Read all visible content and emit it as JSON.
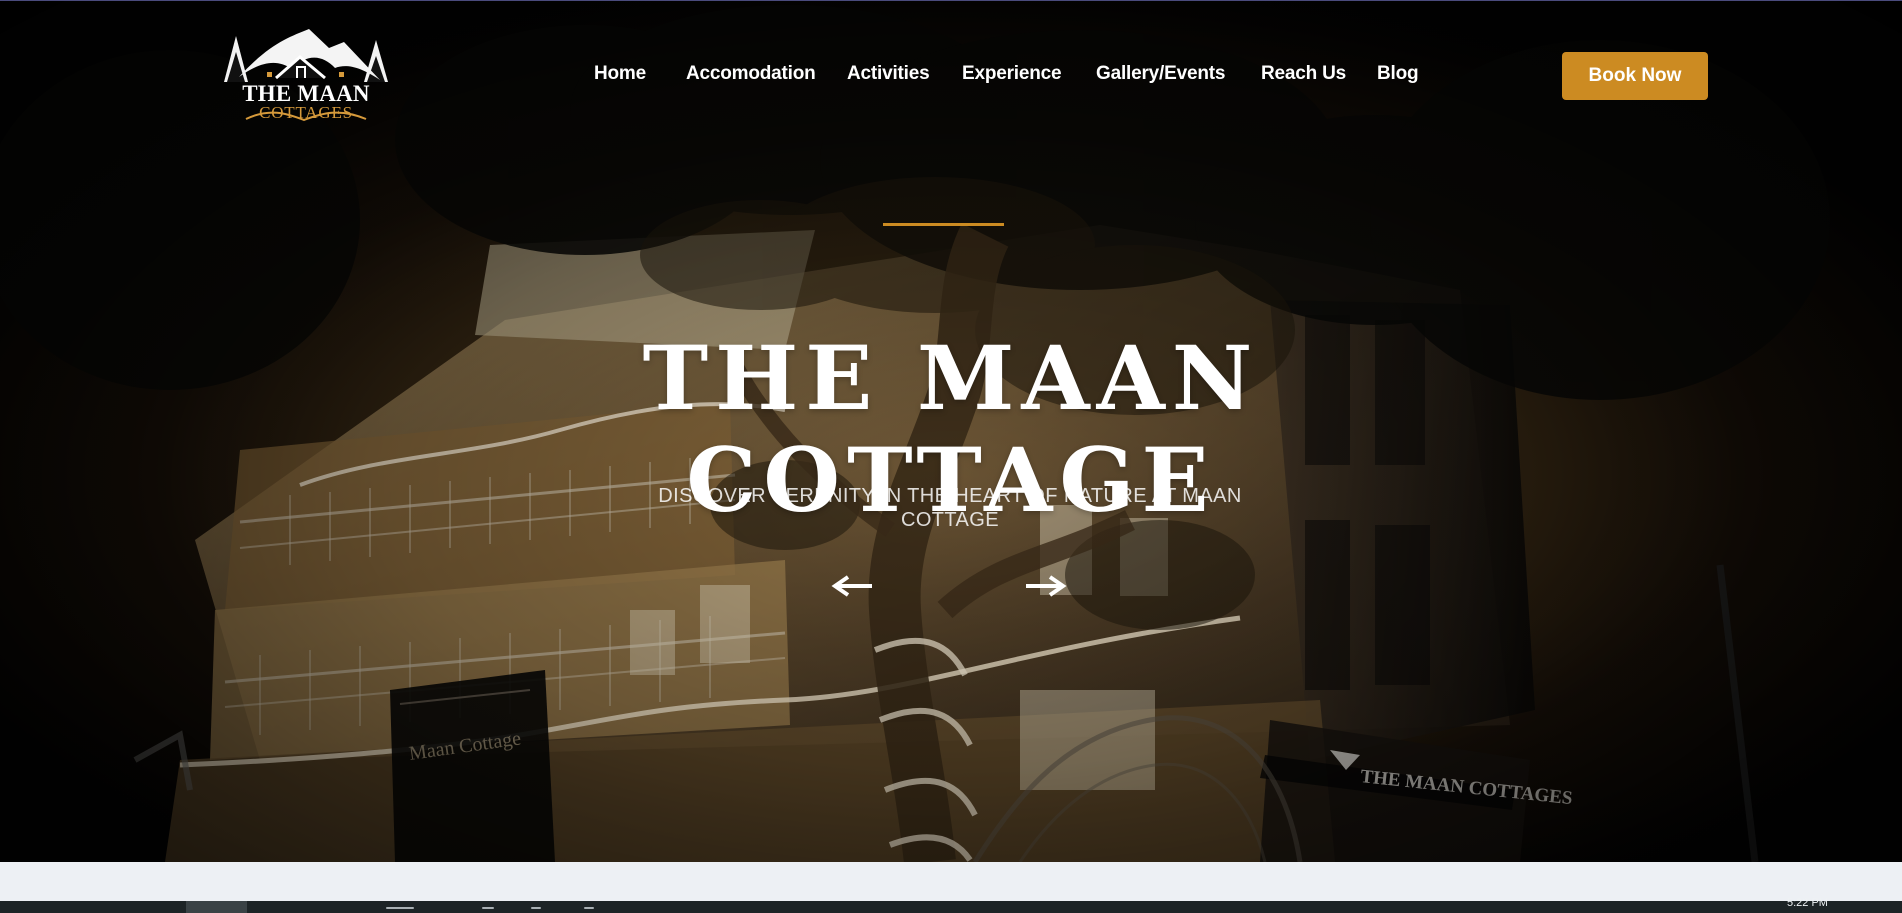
{
  "brand": {
    "logo_line1": "THE MAAN",
    "logo_line2": "COTTAGES",
    "accent_color": "#cc8b22"
  },
  "navigation": {
    "items": [
      {
        "label": "Home"
      },
      {
        "label": "Accomodation"
      },
      {
        "label": "Activities"
      },
      {
        "label": "Experience"
      },
      {
        "label": "Gallery/Events"
      },
      {
        "label": "Reach Us"
      },
      {
        "label": "Blog"
      }
    ],
    "cta_label": "Book Now"
  },
  "hero": {
    "title_line1": "THE MAAN",
    "title_line2": "COTTAGE",
    "subtitle": "DISCOVER SERENITY IN THE HEART OF NATURE AT MAAN COTTAGE",
    "building_sign_left": "Maan Cottage",
    "building_sign_right": "THE MAAN COTTAGES",
    "previous_icon": "left-arrow-icon",
    "next_icon": "right-arrow-icon"
  },
  "taskbar": {
    "clock": "5:22 PM"
  }
}
